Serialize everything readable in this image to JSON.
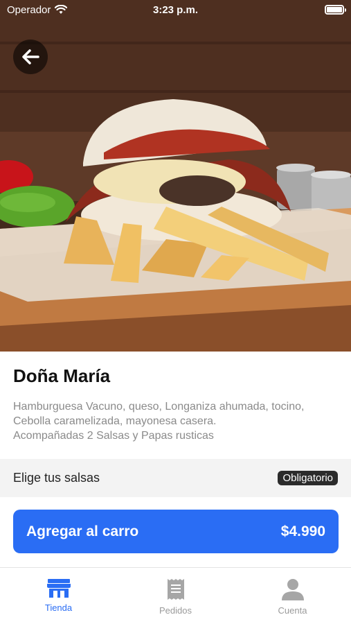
{
  "status_bar": {
    "carrier": "Operador",
    "time": "3:23 p.m."
  },
  "product": {
    "name": "Doña María",
    "description_lines": [
      "Hamburguesa Vacuno, queso, Longaniza ahumada, tocino,",
      "Cebolla caramelizada, mayonesa casera.",
      "Acompañadas 2 Salsas y Papas rusticas"
    ]
  },
  "options": {
    "sauce_label": "Elige tus salsas",
    "required_badge": "Obligatorio"
  },
  "cart_button": {
    "label": "Agregar al carro",
    "price": "$4.990"
  },
  "tab_bar": {
    "items": [
      {
        "label": "Tienda",
        "icon": "store-icon",
        "active": true
      },
      {
        "label": "Pedidos",
        "icon": "receipt-icon",
        "active": false
      },
      {
        "label": "Cuenta",
        "icon": "user-icon",
        "active": false
      }
    ]
  },
  "colors": {
    "accent": "#2a6df4",
    "badge_bg": "#2b2b2b",
    "section_bg": "#f3f3f3",
    "inactive_tab": "#9a9a9a"
  }
}
